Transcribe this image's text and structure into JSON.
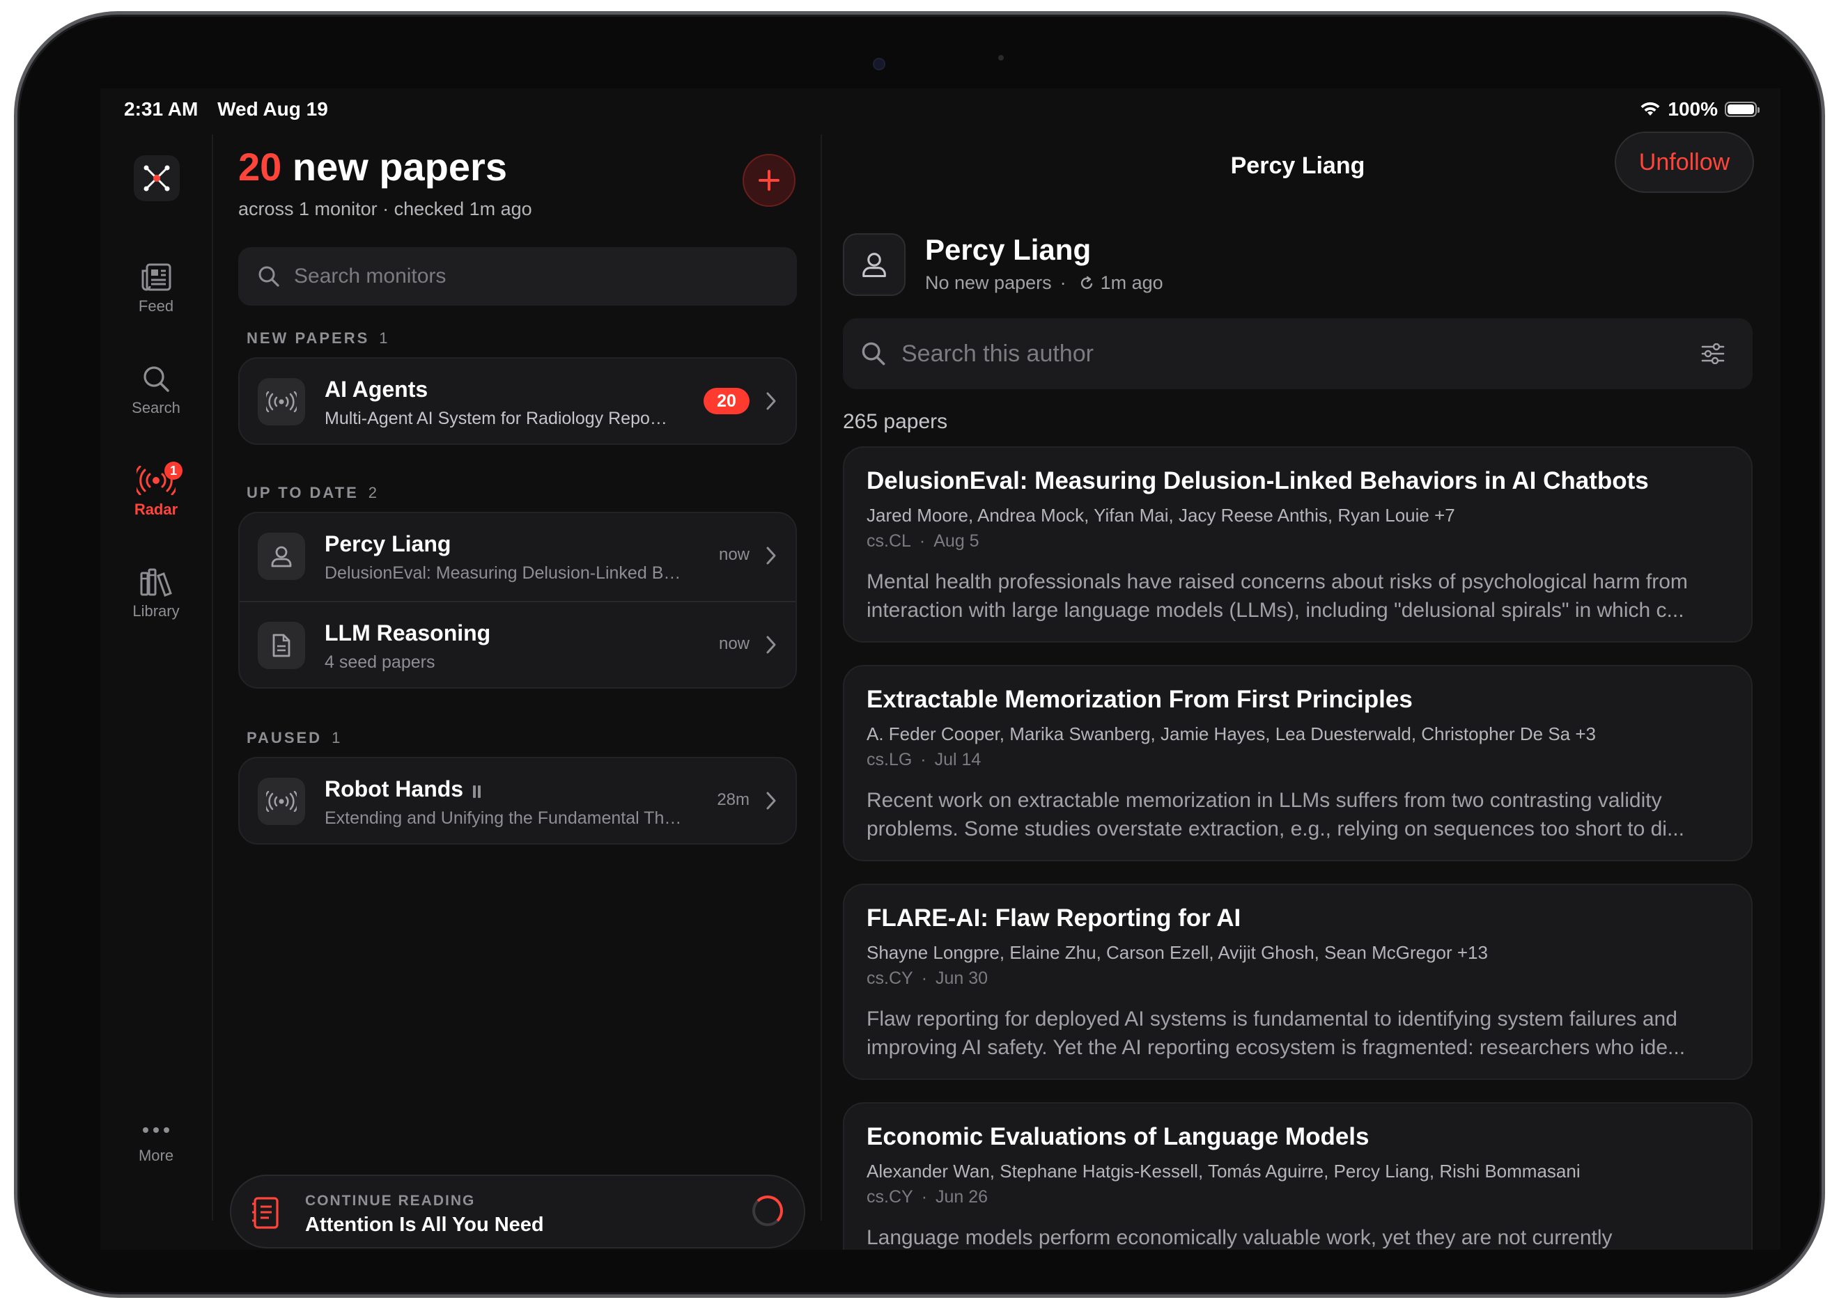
{
  "status_bar": {
    "time": "2:31 AM",
    "date": "Wed Aug 19",
    "battery": "100%"
  },
  "rail": {
    "items": [
      {
        "label": "Feed",
        "icon": "newspaper-icon"
      },
      {
        "label": "Search",
        "icon": "search-icon"
      },
      {
        "label": "Radar",
        "icon": "radar-icon",
        "badge": "1",
        "active": true
      },
      {
        "label": "Library",
        "icon": "books-icon"
      }
    ],
    "more_label": "More"
  },
  "monitors": {
    "count": "20",
    "headline_suffix": "new papers",
    "subline": "across 1 monitor · checked 1m ago",
    "search_placeholder": "Search monitors",
    "sections": {
      "new": {
        "label": "NEW PAPERS",
        "count": "1"
      },
      "uptodate": {
        "label": "UP TO DATE",
        "count": "2"
      },
      "paused": {
        "label": "PAUSED",
        "count": "1"
      }
    },
    "items": {
      "ai_agents": {
        "title": "AI Agents",
        "subtitle": "Multi-Agent AI System for Radiology Report Generation",
        "badge": "20"
      },
      "percy": {
        "title": "Percy Liang",
        "subtitle": "DelusionEval: Measuring Delusion-Linked Behaviors in AI Chatbots",
        "time": "now"
      },
      "llm": {
        "title": "LLM Reasoning",
        "subtitle": "4 seed papers",
        "time": "now"
      },
      "robot": {
        "title": "Robot Hands",
        "subtitle": "Extending and Unifying the Fundamental Theorem of Grasping",
        "time": "28m"
      }
    },
    "continue_reading": {
      "label": "CONTINUE READING",
      "title": "Attention Is All You Need"
    }
  },
  "author": {
    "nav_title": "Percy Liang",
    "unfollow_label": "Unfollow",
    "name": "Percy Liang",
    "status": "No new papers",
    "checked": "1m ago",
    "search_placeholder": "Search this author",
    "paper_count": "265 papers",
    "papers": [
      {
        "title": "DelusionEval: Measuring Delusion-Linked Behaviors in AI Chatbots",
        "authors": "Jared Moore, Andrea Mock, Yifan Mai, Jacy Reese Anthis, Ryan Louie +7",
        "category": "cs.CL",
        "date": "Aug 5",
        "abstract": "Mental health professionals have raised concerns about risks of psychological harm from interaction with large language models (LLMs), including \"delusional spirals\" in which c..."
      },
      {
        "title": "Extractable Memorization From First Principles",
        "authors": "A. Feder Cooper, Marika Swanberg, Jamie Hayes, Lea Duesterwald, Christopher De Sa +3",
        "category": "cs.LG",
        "date": "Jul 14",
        "abstract": "Recent work on extractable memorization in LLMs suffers from two contrasting validity problems. Some studies overstate extraction, e.g., relying on sequences too short to di..."
      },
      {
        "title": "FLARE-AI: Flaw Reporting for AI",
        "authors": "Shayne Longpre, Elaine Zhu, Carson Ezell, Avijit Ghosh, Sean McGregor +13",
        "category": "cs.CY",
        "date": "Jun 30",
        "abstract": "Flaw reporting for deployed AI systems is fundamental to identifying system failures and improving AI safety. Yet the AI reporting ecosystem is fragmented: researchers who ide..."
      },
      {
        "title": "Economic Evaluations of Language Models",
        "authors": "Alexander Wan, Stephane Hatgis-Kessell, Tomás Aguirre, Percy Liang, Rishi Bommasani",
        "category": "cs.CY",
        "date": "Jun 26",
        "abstract": "Language models perform economically valuable work, yet they are not currently"
      }
    ]
  },
  "colors": {
    "accent": "#ff453a",
    "background": "#0f0f10",
    "card": "#19191b"
  }
}
